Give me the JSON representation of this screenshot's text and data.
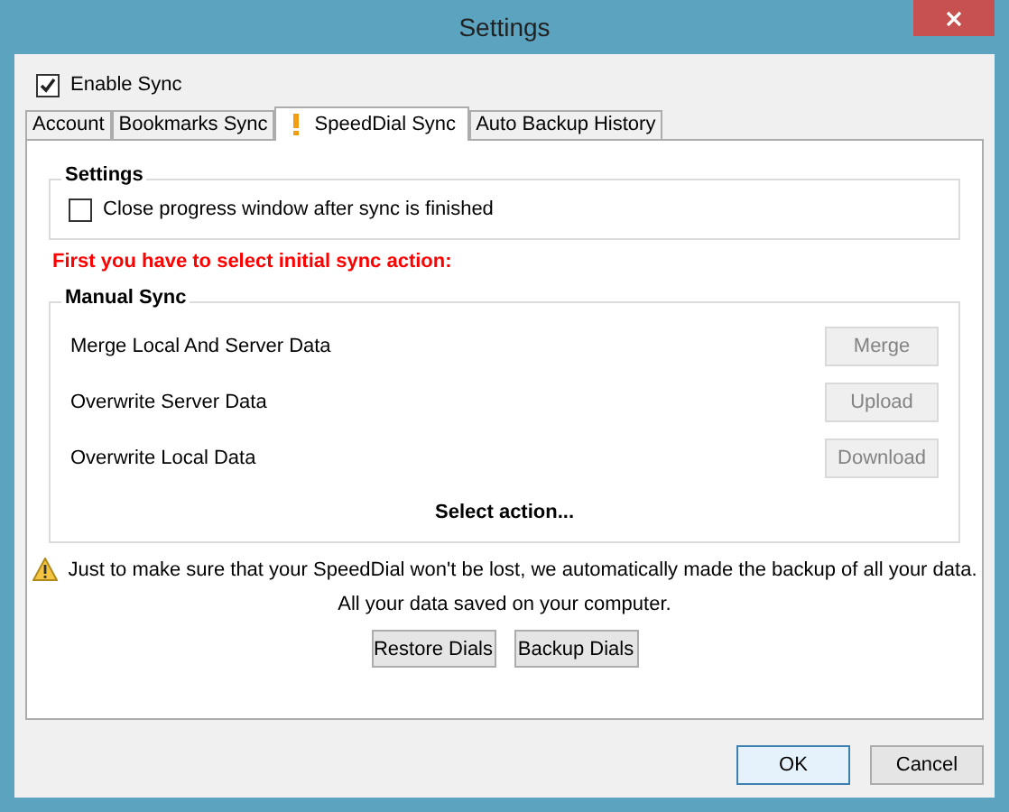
{
  "window": {
    "title": "Settings"
  },
  "enable_sync": {
    "label": "Enable Sync",
    "checked": true
  },
  "tabs": [
    {
      "label": "Account",
      "selected": false,
      "warning": false
    },
    {
      "label": "Bookmarks Sync",
      "selected": false,
      "warning": false
    },
    {
      "label": "SpeedDial Sync",
      "selected": true,
      "warning": true
    },
    {
      "label": "Auto Backup History",
      "selected": false,
      "warning": false
    }
  ],
  "settings_group": {
    "title": "Settings",
    "option": {
      "label": "Close progress window after sync is finished",
      "checked": false
    }
  },
  "alert": "First you have to select initial sync action:",
  "manual_sync": {
    "title": "Manual Sync",
    "actions": [
      {
        "label": "Merge Local And Server Data",
        "button": "Merge",
        "disabled": true
      },
      {
        "label": "Overwrite Server Data",
        "button": "Upload",
        "disabled": true
      },
      {
        "label": "Overwrite Local Data",
        "button": "Download",
        "disabled": true
      }
    ],
    "status": "Select action..."
  },
  "notice": "Just to make sure that your SpeedDial won't be lost, we automatically made the backup of all your data.",
  "saved_note": "All your data saved on your computer.",
  "backup_buttons": [
    "Restore Dials",
    "Backup Dials"
  ],
  "footer_buttons": [
    {
      "label": "OK",
      "default": true
    },
    {
      "label": "Cancel",
      "default": false
    }
  ]
}
